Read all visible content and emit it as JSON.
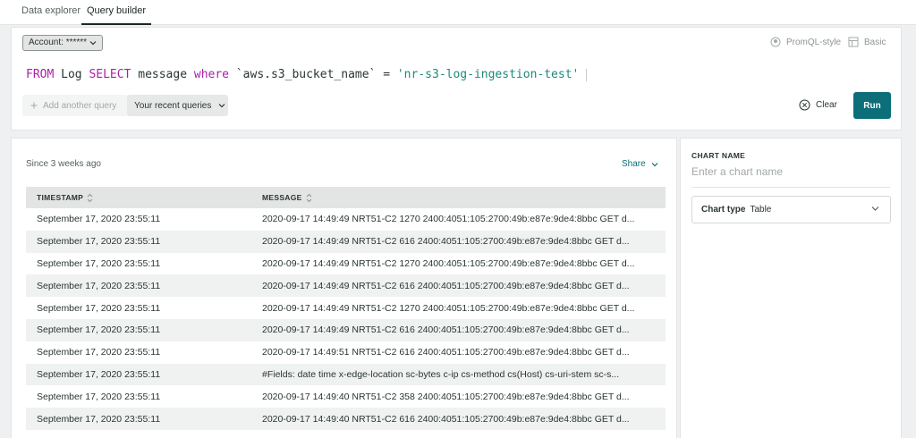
{
  "tabs": [
    {
      "label": "Data explorer"
    },
    {
      "label": "Query builder"
    }
  ],
  "query": {
    "account_label": "Account: ******",
    "modes": {
      "promql": "PromQL-style",
      "basic": "Basic"
    },
    "tokens": {
      "from": "FROM",
      "source": " Log ",
      "select": "SELECT",
      "field": " message ",
      "where": "where",
      "condition": " `aws.s3_bucket_name` = ",
      "value": "'nr-s3-log-ingestion-test'"
    },
    "add_query_label": "Add another query",
    "recent_queries_label": "Your recent queries",
    "clear_label": "Clear",
    "run_label": "Run"
  },
  "results": {
    "since": "Since 3 weeks ago",
    "share_label": "Share",
    "columns": [
      "TIMESTAMP",
      "MESSAGE"
    ],
    "rows": [
      [
        "September 17, 2020 23:55:11",
        "2020-09-17 14:49:49 NRT51-C2 1270 2400:4051:105:2700:49b:e87e:9de4:8bbc GET d..."
      ],
      [
        "September 17, 2020 23:55:11",
        "2020-09-17 14:49:49 NRT51-C2 616 2400:4051:105:2700:49b:e87e:9de4:8bbc GET d..."
      ],
      [
        "September 17, 2020 23:55:11",
        "2020-09-17 14:49:49 NRT51-C2 1270 2400:4051:105:2700:49b:e87e:9de4:8bbc GET d..."
      ],
      [
        "September 17, 2020 23:55:11",
        "2020-09-17 14:49:49 NRT51-C2 616 2400:4051:105:2700:49b:e87e:9de4:8bbc GET d..."
      ],
      [
        "September 17, 2020 23:55:11",
        "2020-09-17 14:49:49 NRT51-C2 1270 2400:4051:105:2700:49b:e87e:9de4:8bbc GET d..."
      ],
      [
        "September 17, 2020 23:55:11",
        "2020-09-17 14:49:49 NRT51-C2 616 2400:4051:105:2700:49b:e87e:9de4:8bbc GET d..."
      ],
      [
        "September 17, 2020 23:55:11",
        "2020-09-17 14:49:51 NRT51-C2 616 2400:4051:105:2700:49b:e87e:9de4:8bbc GET d..."
      ],
      [
        "September 17, 2020 23:55:11",
        "#Fields: date time x-edge-location sc-bytes c-ip cs-method cs(Host) cs-uri-stem sc-s..."
      ],
      [
        "September 17, 2020 23:55:11",
        "2020-09-17 14:49:40 NRT51-C2 358 2400:4051:105:2700:49b:e87e:9de4:8bbc GET d..."
      ],
      [
        "September 17, 2020 23:55:11",
        "2020-09-17 14:49:40 NRT51-C2 616 2400:4051:105:2700:49b:e87e:9de4:8bbc GET d..."
      ]
    ]
  },
  "chart_settings": {
    "name_label": "CHART NAME",
    "name_placeholder": "Enter a chart name",
    "type_label": "Chart type",
    "type_value": "Table"
  },
  "colors": {
    "accent": "#0b6e79",
    "keyword": "#aa1eaa",
    "string": "#1a8a7a"
  },
  "icons": [
    "chevron-down-icon",
    "promql-icon",
    "basic-icon",
    "plus-icon",
    "clear-icon",
    "sort-icon"
  ]
}
